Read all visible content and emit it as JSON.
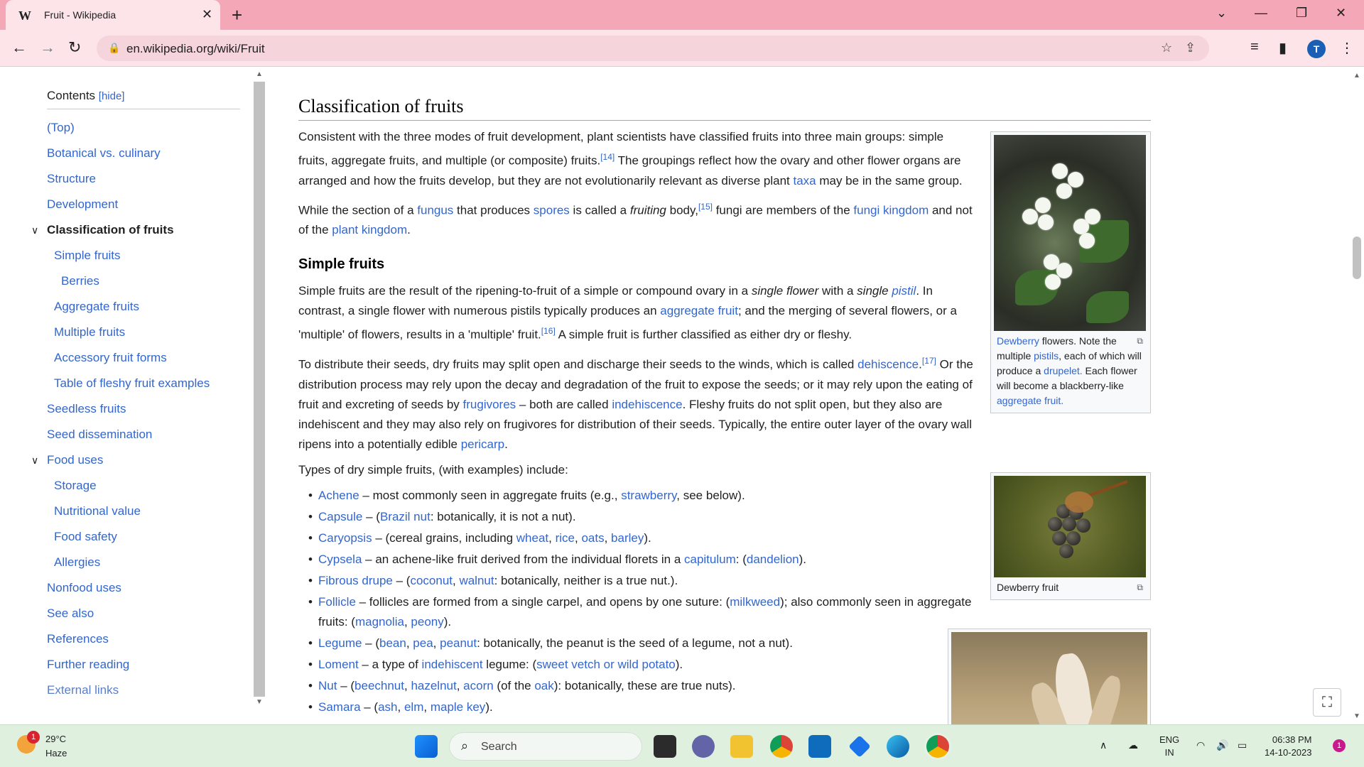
{
  "browser": {
    "tab_title": "Fruit - Wikipedia",
    "tab_favicon": "W",
    "url": "en.wikipedia.org/wiki/Fruit",
    "profile_initial": "T",
    "icons": {
      "back": "arrow-left-icon",
      "forward": "arrow-right-icon",
      "reload": "reload-icon",
      "lock": "lock-icon",
      "share": "share-icon",
      "bookmark": "star-icon",
      "reading_list": "reading-list-icon",
      "side_panel": "side-panel-icon",
      "menu": "kebab-menu-icon"
    }
  },
  "toc": {
    "title": "Contents",
    "hide_label": "[hide]",
    "items": [
      {
        "label": "(Top)",
        "level": 1
      },
      {
        "label": "Botanical vs. culinary",
        "level": 1
      },
      {
        "label": "Structure",
        "level": 1
      },
      {
        "label": "Development",
        "level": 1
      },
      {
        "label": "Classification of fruits",
        "level": 1,
        "active": true
      },
      {
        "label": "Simple fruits",
        "level": 2
      },
      {
        "label": "Berries",
        "level": 3
      },
      {
        "label": "Aggregate fruits",
        "level": 2
      },
      {
        "label": "Multiple fruits",
        "level": 2
      },
      {
        "label": "Accessory fruit forms",
        "level": 2
      },
      {
        "label": "Table of fleshy fruit examples",
        "level": 2
      },
      {
        "label": "Seedless fruits",
        "level": 1
      },
      {
        "label": "Seed dissemination",
        "level": 1
      },
      {
        "label": "Food uses",
        "level": 1
      },
      {
        "label": "Storage",
        "level": 2
      },
      {
        "label": "Nutritional value",
        "level": 2
      },
      {
        "label": "Food safety",
        "level": 2
      },
      {
        "label": "Allergies",
        "level": 2
      },
      {
        "label": "Nonfood uses",
        "level": 1
      },
      {
        "label": "See also",
        "level": 1
      },
      {
        "label": "References",
        "level": 1
      },
      {
        "label": "Further reading",
        "level": 1
      },
      {
        "label": "External links",
        "level": 1
      }
    ]
  },
  "article": {
    "section_title": "Classification of fruits",
    "subsection_title": "Simple fruits",
    "types_intro": "Types of dry simple fruits, (with examples) include:",
    "citations": {
      "c14": "[14]",
      "c15": "[15]",
      "c16": "[16]",
      "c17": "[17]"
    }
  },
  "figures": [
    {
      "caption_link1": "Dewberry",
      "caption_text": "flowers. Note the multiple",
      "caption_link2": "pistils",
      "caption_text2": ", each of which will produce a",
      "caption_link3": "drupelet.",
      "caption_text3": "Each flower will become a blackberry-like",
      "caption_link4": "aggregate fruit."
    },
    {
      "caption": "Dewberry fruit"
    }
  ],
  "taskbar": {
    "temperature": "29°C",
    "condition": "Haze",
    "weather_badge": "1",
    "search_placeholder": "Search",
    "lang_top": "ENG",
    "lang_bottom": "IN",
    "time": "06:38 PM",
    "date": "14-10-2023",
    "notification_count": "1"
  }
}
